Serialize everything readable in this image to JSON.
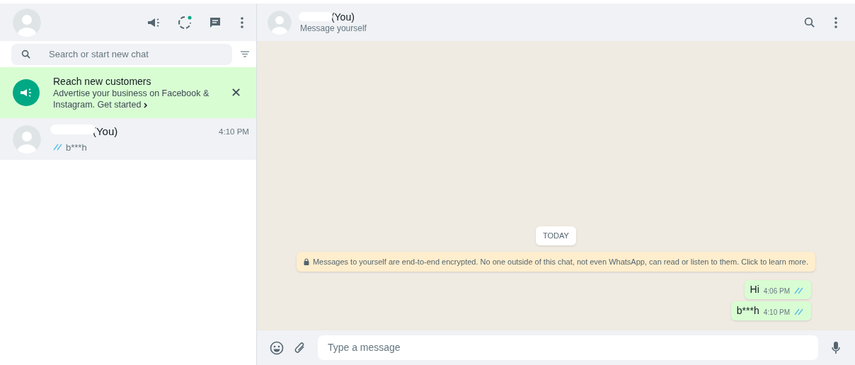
{
  "sidebar": {
    "search": {
      "placeholder": "Search or start new chat"
    },
    "banner": {
      "title": "Reach new customers",
      "text": "Advertise your business on Facebook & Instagram.",
      "link": "Get started",
      "close": "✕"
    },
    "chats": [
      {
        "name": "(You)",
        "preview": "b***h",
        "time": "4:10 PM",
        "read": true,
        "selected": true
      }
    ]
  },
  "conversation": {
    "name": "(You)",
    "subtitle": "Message yourself",
    "date": "TODAY",
    "notice": "Messages to yourself are end-to-end encrypted. No one outside of this chat, not even WhatsApp, can read or listen to them. Click to learn more.",
    "messages": [
      {
        "text": "Hi",
        "time": "4:06 PM",
        "read": true
      },
      {
        "text": "b***h",
        "time": "4:10 PM",
        "read": true
      }
    ],
    "composer": {
      "placeholder": "Type a message"
    }
  }
}
